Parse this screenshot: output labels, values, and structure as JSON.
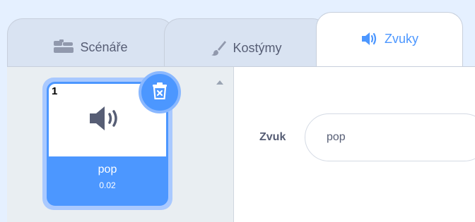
{
  "tabs": [
    {
      "label": "Scénáře",
      "icon": "code-blocks-icon",
      "active": false
    },
    {
      "label": "Kostýmy",
      "icon": "paintbrush-icon",
      "active": false
    },
    {
      "label": "Zvuky",
      "icon": "speaker-icon",
      "active": true
    }
  ],
  "sound_list": {
    "items": [
      {
        "index": "1",
        "name": "pop",
        "duration": "0.02",
        "selected": true,
        "icon": "speaker-icon"
      }
    ],
    "delete_icon": "trash-icon"
  },
  "editor": {
    "name_label": "Zvuk",
    "name_value": "pop"
  },
  "colors": {
    "accent": "#4c97ff",
    "tab_bg": "#d9e3f2",
    "page_bg": "#e5f0ff",
    "text": "#575e75",
    "list_bg": "#e9eef2"
  }
}
